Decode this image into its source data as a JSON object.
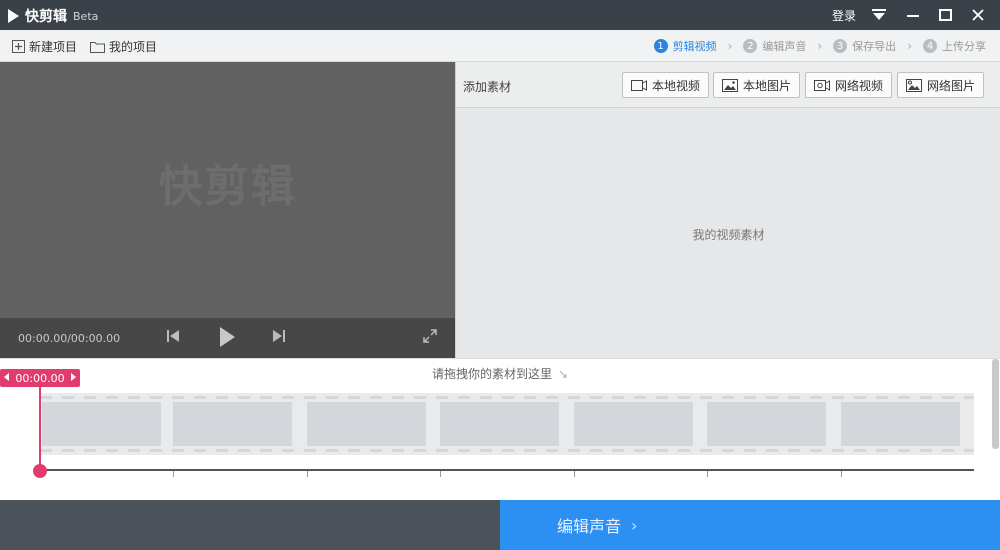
{
  "app": {
    "name": "快剪辑",
    "badge": "Beta"
  },
  "window": {
    "login_label": "登录"
  },
  "toolbar": {
    "new_project": "新建项目",
    "my_projects": "我的项目"
  },
  "steps": [
    {
      "num": "1",
      "label": "剪辑视频",
      "active": true
    },
    {
      "num": "2",
      "label": "编辑声音",
      "active": false
    },
    {
      "num": "3",
      "label": "保存导出",
      "active": false
    },
    {
      "num": "4",
      "label": "上传分享",
      "active": false
    }
  ],
  "preview": {
    "watermark": "快剪辑",
    "time": "00:00.00/00:00.00"
  },
  "material": {
    "title": "添加素材",
    "buttons": [
      "本地视频",
      "本地图片",
      "网络视频",
      "网络图片"
    ],
    "empty_text": "我的视频素材"
  },
  "timeline": {
    "drag_hint": "请拖拽你的素材到这里",
    "playhead_time": "00:00.00"
  },
  "footer": {
    "next_button": "编辑声音"
  },
  "colors": {
    "accent": "#2c8ff2",
    "playhead": "#e23c6e",
    "titlebar": "#3b4148"
  }
}
